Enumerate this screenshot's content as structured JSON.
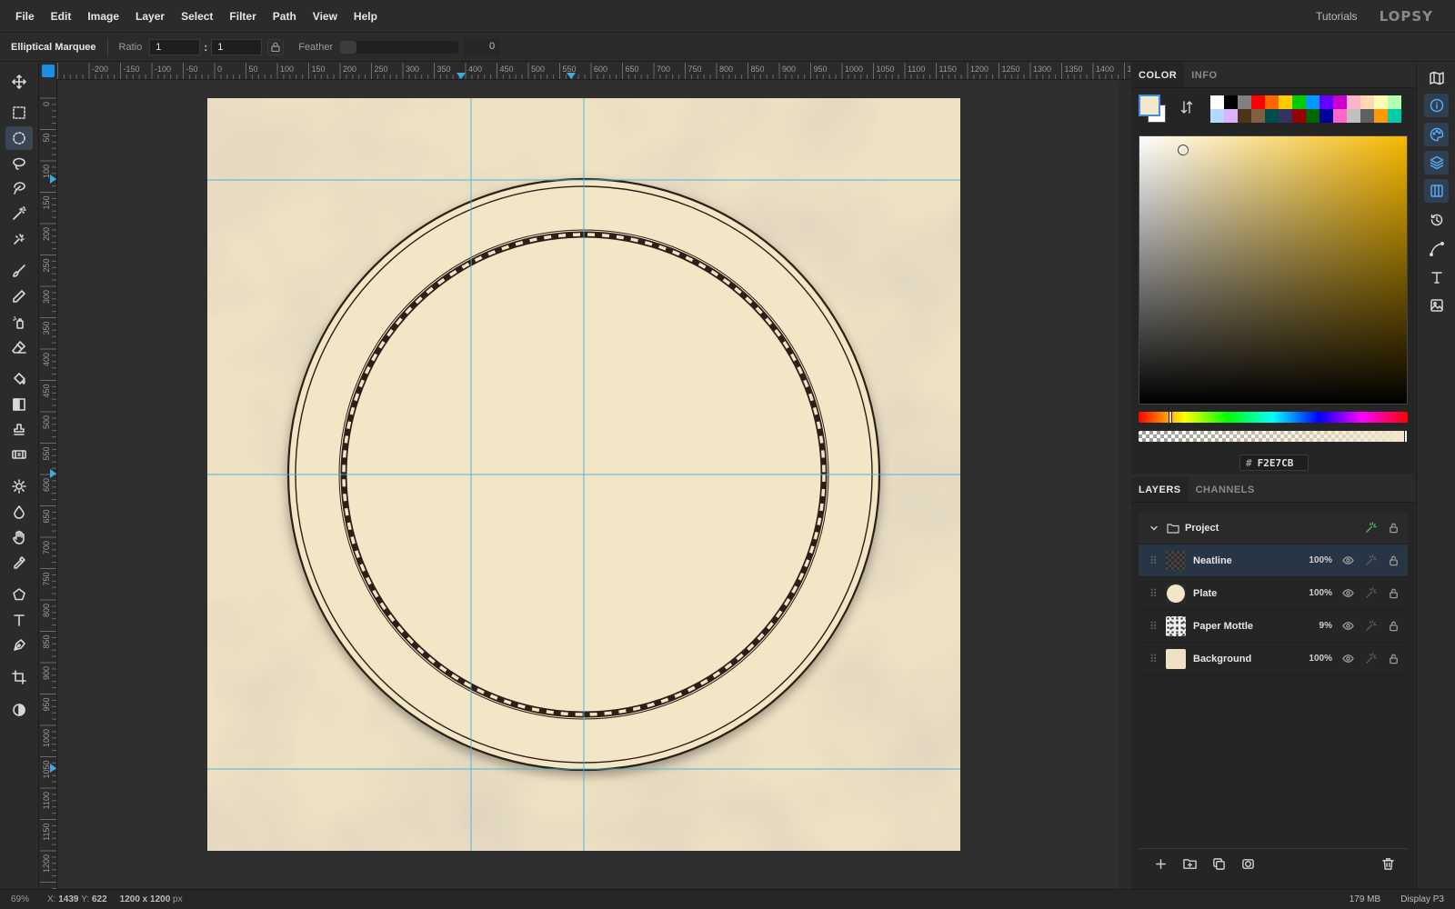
{
  "menubar": {
    "items": [
      "File",
      "Edit",
      "Image",
      "Layer",
      "Select",
      "Filter",
      "Path",
      "View",
      "Help"
    ],
    "tutorials": "Tutorials",
    "logo": "LOPSY"
  },
  "options": {
    "tool_name": "Elliptical Marquee",
    "ratio_label": "Ratio",
    "ratio_w": "1",
    "ratio_sep": ":",
    "ratio_h": "1",
    "feather_label": "Feather",
    "feather_value": "0"
  },
  "tools": [
    "move-icon",
    "rect-select-icon",
    "ellipse-select-icon",
    "lasso-icon",
    "magnetic-lasso-icon",
    "magic-wand-icon",
    "quick-select-icon",
    "brush-icon",
    "pencil-icon",
    "spray-icon",
    "eraser-icon",
    "bucket-icon",
    "gradient-icon",
    "stamp-icon",
    "patch-icon",
    "dodge-icon",
    "blur-icon",
    "hand-icon",
    "eyedropper-icon",
    "polygon-icon",
    "text-icon",
    "pen-icon",
    "crop-icon",
    "mask-toggle-icon"
  ],
  "active_tool": "ellipse-select-icon",
  "rulers": {
    "h_labels": [
      "-200",
      "-150",
      "-100",
      "-50",
      "0",
      "50",
      "100",
      "150",
      "200",
      "250",
      "300",
      "350",
      "400",
      "450",
      "500",
      "550",
      "600",
      "650",
      "700",
      "750",
      "800",
      "850",
      "900",
      "950",
      "1000",
      "1050",
      "1100",
      "1150",
      "1200",
      "1250",
      "1300",
      "1350",
      "1400",
      "14"
    ],
    "v_labels": [
      "0",
      "50",
      "100",
      "150",
      "200",
      "250",
      "300",
      "350",
      "400",
      "450",
      "500",
      "550",
      "600",
      "650",
      "700",
      "750",
      "800",
      "850",
      "900",
      "950",
      "1000",
      "1050",
      "1100",
      "1150",
      "1200"
    ]
  },
  "color_panel": {
    "tabs": [
      "COLOR",
      "INFO"
    ],
    "active_tab": "COLOR",
    "foreground": "#F2E7CB",
    "background": "#FFFFFF",
    "hex_label": "#",
    "hex": "F2E7CB",
    "palette": [
      "#ffffff",
      "#000000",
      "#808080",
      "#ff0000",
      "#ff6600",
      "#ffcc00",
      "#00cc00",
      "#0099ff",
      "#6600ff",
      "#cc00cc",
      "#ffb3c6",
      "#ffd9b3",
      "#ffffb3",
      "#b3ffb3",
      "#b3d9ff",
      "#d9b3ff",
      "#4d3319",
      "#806040",
      "#004d4d",
      "#333366",
      "#990000",
      "#006600",
      "#000099",
      "#ff66cc",
      "#c0c0c0",
      "#606060",
      "#ff9900",
      "#00ccaa"
    ]
  },
  "layers_panel": {
    "tabs": [
      "LAYERS",
      "CHANNELS"
    ],
    "active_tab": "LAYERS",
    "group": "Project",
    "layers": [
      {
        "name": "Neatline",
        "opacity": "100%"
      },
      {
        "name": "Plate",
        "opacity": "100%"
      },
      {
        "name": "Paper Mottle",
        "opacity": "9%"
      },
      {
        "name": "Background",
        "opacity": "100%"
      }
    ],
    "selected_layer": "Neatline"
  },
  "right_strip": [
    "map-icon",
    "info-icon",
    "palette-icon",
    "layers-icon",
    "columns-icon",
    "history-icon",
    "curve-icon",
    "type-icon",
    "image-icon"
  ],
  "statusbar": {
    "zoom": "69%",
    "x_label": "X:",
    "x": "1439",
    "y_label": "Y:",
    "y": "622",
    "dims": "1200 x 1200",
    "dims_unit": "px",
    "memory": "179 MB",
    "profile": "Display P3"
  }
}
